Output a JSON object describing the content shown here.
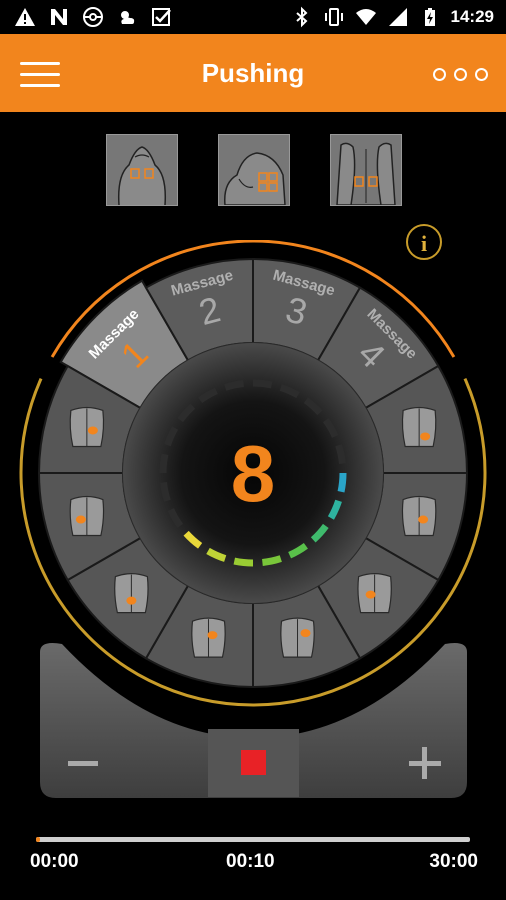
{
  "status_bar": {
    "time": "14:29",
    "icons_left": [
      "warning-icon",
      "n-icon",
      "pokeball-icon",
      "weather-icon",
      "check-icon"
    ],
    "icons_right": [
      "bluetooth-icon",
      "vibrate-icon",
      "wifi-icon",
      "signal-icon",
      "battery-icon"
    ]
  },
  "app_bar": {
    "title": "Pushing",
    "menu_icon": "hamburger-icon",
    "more_icon": "more-dots-icon",
    "color": "#f2851d"
  },
  "body_zones": [
    "upper-back",
    "shoulder",
    "abdomen"
  ],
  "info_label": "i",
  "programs": [
    {
      "label": "Massage",
      "number": "1",
      "selected": true
    },
    {
      "label": "Massage",
      "number": "2",
      "selected": false
    },
    {
      "label": "Massage",
      "number": "3",
      "selected": false
    },
    {
      "label": "Massage",
      "number": "4",
      "selected": false
    }
  ],
  "intensity": {
    "value": "8",
    "level": 8,
    "max": 20
  },
  "pad_positions": [
    "feet",
    "lower-leg",
    "knee",
    "upper-back-right",
    "upper-back-left",
    "lower-back",
    "chest",
    "thigh"
  ],
  "controls": {
    "minus": "−",
    "plus": "+",
    "stop_color": "#e82226"
  },
  "progress": {
    "elapsed": "00:00",
    "middle": "00:10",
    "total": "30:00",
    "fraction": 0.01
  }
}
